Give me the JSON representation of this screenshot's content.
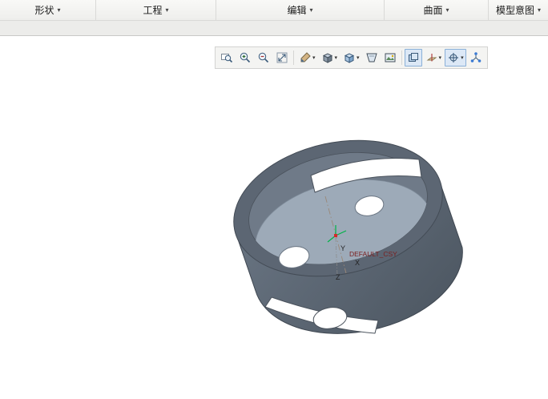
{
  "menu_bar": {
    "dropdown_glyph": "▾",
    "items": [
      {
        "label": "形状"
      },
      {
        "label": "工程"
      },
      {
        "label": "编辑"
      },
      {
        "label": "曲面"
      },
      {
        "label": "模型意图"
      }
    ]
  },
  "toolbar": {
    "dropdown_glyph": "▾",
    "buttons": [
      {
        "icon": "zoom-window-icon",
        "active": false,
        "has_dropdown": false
      },
      {
        "icon": "zoom-in-icon",
        "active": false,
        "has_dropdown": false
      },
      {
        "icon": "zoom-out-icon",
        "active": false,
        "has_dropdown": false
      },
      {
        "icon": "refit-icon",
        "active": false,
        "has_dropdown": false
      },
      {
        "icon": "repaint-icon",
        "active": false,
        "has_dropdown": true
      },
      {
        "icon": "saved-views-icon",
        "active": false,
        "has_dropdown": true
      },
      {
        "icon": "display-style-icon",
        "active": false,
        "has_dropdown": true
      },
      {
        "icon": "perspective-icon",
        "active": false,
        "has_dropdown": false
      },
      {
        "icon": "render-icon",
        "active": false,
        "has_dropdown": false
      },
      {
        "icon": "view-manager-icon",
        "active": true,
        "has_dropdown": false
      },
      {
        "icon": "datum-display-icon",
        "active": false,
        "has_dropdown": true
      },
      {
        "icon": "annotation-display-icon",
        "active": true,
        "has_dropdown": true
      },
      {
        "icon": "spin-center-icon",
        "active": false,
        "has_dropdown": false
      }
    ]
  },
  "viewport": {
    "csys_label": "DEFAULT_CSY",
    "axis_x": "X",
    "axis_y": "Y",
    "axis_z": "Z"
  },
  "colors": {
    "model_body": "#5f6a77",
    "model_rim": "#5c6673",
    "model_floor": "#9daab8",
    "csys_label": "#7a1f1f",
    "axis_green": "#00b347",
    "toolbar_active_bg": "#dce8f6"
  }
}
